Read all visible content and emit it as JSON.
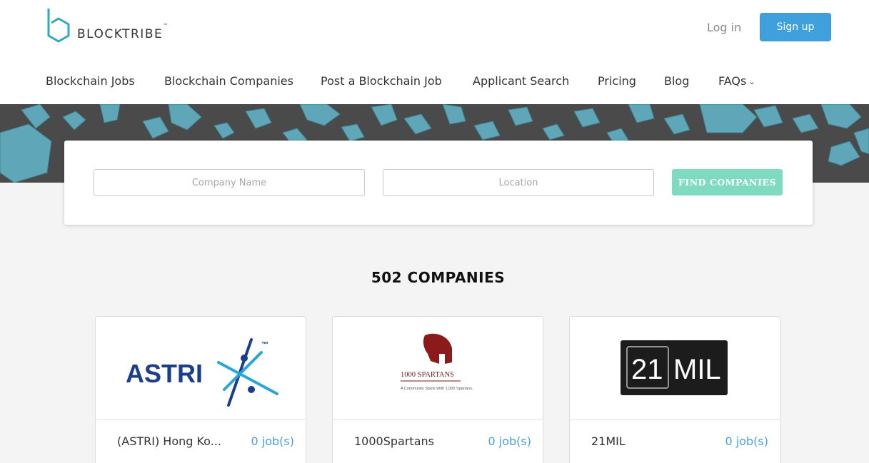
{
  "header": {
    "brand": "BLOCKTRIBE",
    "trademark": "™",
    "login_label": "Log in",
    "signup_label": "Sign up"
  },
  "nav": {
    "items": [
      {
        "label": "Blockchain Jobs"
      },
      {
        "label": "Blockchain Companies"
      },
      {
        "label": "Post a Blockchain Job"
      },
      {
        "label": "Applicant Search"
      },
      {
        "label": "Pricing"
      },
      {
        "label": "Blog"
      },
      {
        "label": "FAQs",
        "has_dropdown": true
      }
    ]
  },
  "search": {
    "company_placeholder": "Company Name",
    "location_placeholder": "Location",
    "button_label": "FIND COMPANIES"
  },
  "results": {
    "count_label": "502 COMPANIES"
  },
  "companies": [
    {
      "name": "(ASTRI) Hong Ko...",
      "jobs": "0 job(s)",
      "logo_icon": "astri-logo",
      "logo_text": "ASTRI",
      "logo_tm": "™"
    },
    {
      "name": "1000Spartans",
      "jobs": "0 job(s)",
      "logo_icon": "spartan-helmet-logo",
      "logo_title": "1000 SPARTANS",
      "logo_tagline": "A Community Starts With 1,000 Spartans."
    },
    {
      "name": "21MIL",
      "jobs": "0 job(s)",
      "logo_icon": "21mil-logo",
      "logo_num": "21",
      "logo_word": "MIL"
    }
  ],
  "colors": {
    "accent_blue": "#3fa0dc",
    "find_button": "#7fdbbf",
    "logo_teal": "#2fa8c3",
    "hero_cube": "#5fa7b8",
    "hero_bg": "#4a4a4a",
    "jobs_link": "#4a9fd5"
  }
}
